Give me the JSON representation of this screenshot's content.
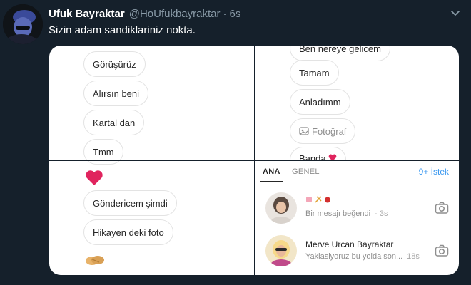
{
  "tweet": {
    "name": "Ufuk Bayraktar",
    "handle": "@HoUfukbayraktar",
    "separator": "·",
    "time": "6s",
    "text": "Sizin adam sandiklariniz nokta."
  },
  "panel_top_left": {
    "messages": [
      "Görüşürüz",
      "Alırsın beni",
      "Kartal dan",
      "Tmm"
    ]
  },
  "panel_top_right": {
    "messages": [
      "Ben nereye gelicem",
      "Tamam",
      "Anladımm",
      "Fotoğraf",
      "Banda"
    ]
  },
  "panel_bottom_left": {
    "messages": [
      "Göndericem şimdi",
      "Hikayen deki foto"
    ]
  },
  "inbox": {
    "tab_primary": "ANA",
    "tab_general": "GENEL",
    "requests": "9+ İstek",
    "threads": [
      {
        "title": "",
        "subtitle": "Bir mesajı beğendi",
        "time": "· 3s"
      },
      {
        "title": "Merve Urcan Bayraktar",
        "subtitle": "Yaklasiyoruz bu yolda son...",
        "time": "18s"
      }
    ]
  },
  "colors": {
    "background": "#15202b",
    "secondary_text": "#8899a6",
    "link_blue": "#3897f0",
    "heart_red": "#e0245e"
  },
  "icons": [
    "chevron-down-icon",
    "heart-icon",
    "photo-icon",
    "camera-icon",
    "handshake-icon"
  ]
}
